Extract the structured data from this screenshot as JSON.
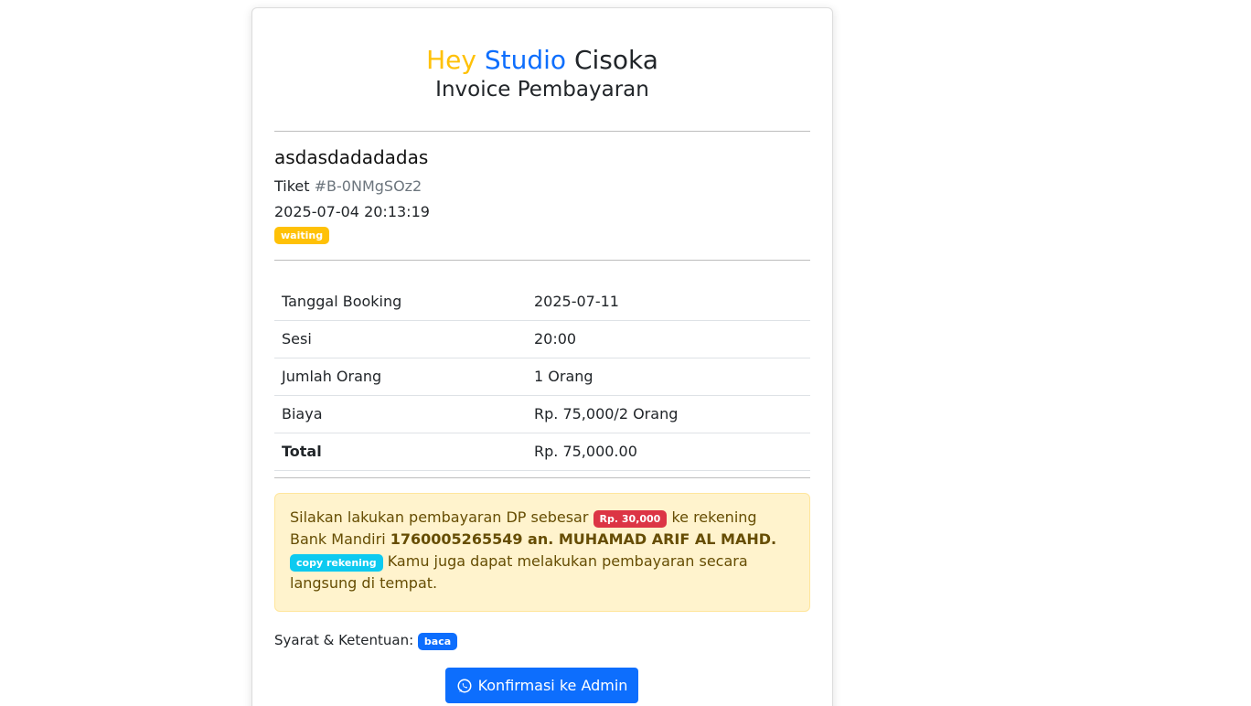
{
  "header": {
    "brand_word1": "Hey",
    "brand_word2": "Studio",
    "brand_word3": "Cisoka",
    "subtitle": "Invoice Pembayaran"
  },
  "customer": {
    "name": "asdasdadadadas",
    "ticket_label": "Tiket",
    "ticket_code": "#B-0NMgSOz2",
    "created_at": "2025-07-04 20:13:19",
    "status": "waiting"
  },
  "details": [
    {
      "label": "Tanggal Booking",
      "value": "2025-07-11"
    },
    {
      "label": "Sesi",
      "value": "20:00"
    },
    {
      "label": "Jumlah Orang",
      "value": "1 Orang"
    },
    {
      "label": "Biaya",
      "value": "Rp. 75,000/2 Orang"
    },
    {
      "label": "Total",
      "value": "Rp. 75,000.00"
    }
  ],
  "payment": {
    "text1": "Silakan lakukan pembayaran DP sebesar",
    "dp_amount": "Rp. 30,000",
    "text2": "ke rekening Bank Mandiri",
    "account": "1760005265549 an. MUHAMAD ARIF AL MAHD.",
    "copy_label": "copy rekening",
    "text3": "Kamu juga dapat melakukan pembayaran secara langsung di tempat."
  },
  "terms": {
    "label": "Syarat & Ketentuan:",
    "link_label": "baca"
  },
  "confirm_button": {
    "icon": "whatsapp-icon",
    "label": "Konfirmasi ke Admin"
  },
  "colors": {
    "primary": "#0d6efd",
    "warning": "#ffc107",
    "danger": "#dc3545",
    "info": "#0dcaf0",
    "alert_bg": "#fff3cd"
  }
}
